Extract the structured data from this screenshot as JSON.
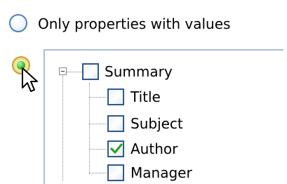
{
  "options": {
    "only_with_values_label": "Only properties with values"
  },
  "tree": {
    "items": [
      {
        "label": "Summary",
        "checked": false
      },
      {
        "label": "Title",
        "checked": false
      },
      {
        "label": "Subject",
        "checked": false
      },
      {
        "label": "Author",
        "checked": true
      },
      {
        "label": "Manager",
        "checked": false
      }
    ]
  },
  "colors": {
    "radio_border": "#4f80b8",
    "checkbox_border": "#2c5a8e",
    "check_mark": "#27a327"
  }
}
